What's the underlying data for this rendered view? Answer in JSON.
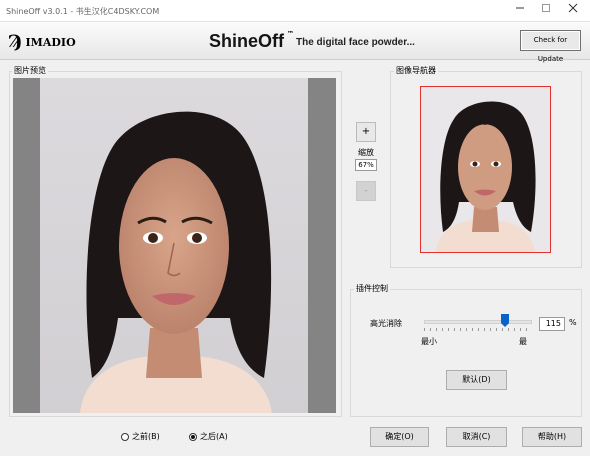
{
  "window": {
    "title": "ShineOff v3.0.1 - 书生汉化C4DSKY.COM",
    "minimize_icon": "minimize-icon",
    "maximize_icon": "maximize-icon",
    "close_icon": "close-icon"
  },
  "banner": {
    "logo_mark": "Ϡ",
    "logo_text": "IMADIO",
    "app_name": "ShineOff",
    "trademark": "™",
    "tagline": "The digital face powder...",
    "update_button": "Check for Update"
  },
  "preview": {
    "group_label": "图片预览"
  },
  "zoom": {
    "in_label": "+",
    "label": "缩放",
    "value": "67%",
    "out_label": "-"
  },
  "navigator": {
    "group_label": "图像导航器",
    "frame_color": "#e0322d"
  },
  "plugin": {
    "group_label": "插件控制",
    "slider_label": "高光消除",
    "slider_value": "115",
    "slider_unit": "%",
    "slider_fraction": 0.75,
    "min_label": "最小",
    "max_label": "最",
    "default_button": "默认(D)"
  },
  "view_mode": {
    "before_label": "之前(B)",
    "after_label": "之后(A)",
    "selected": "after"
  },
  "footer": {
    "ok_button": "确定(O)",
    "cancel_button": "取消(C)",
    "help_button": "帮助(H)"
  }
}
